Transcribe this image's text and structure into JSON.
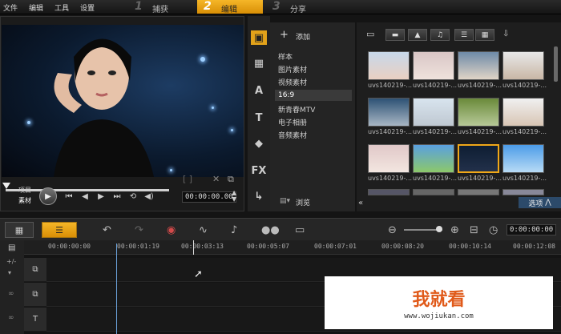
{
  "menu": {
    "file": "文件",
    "edit": "编辑",
    "tools": "工具",
    "settings": "设置"
  },
  "steps": [
    {
      "num": "1",
      "label": "捕获",
      "active": false
    },
    {
      "num": "2",
      "label": "编辑",
      "active": true
    },
    {
      "num": "3",
      "label": "分享",
      "active": false
    }
  ],
  "preview": {
    "project_label": "项目",
    "clip_label": "素材",
    "timecode": "00:00:00.00"
  },
  "library": {
    "add_label": "添加",
    "items": [
      "样本",
      "图片素材",
      "视频素材",
      "16:9",
      "新青春MTV",
      "电子相册",
      "音频素材"
    ],
    "selected_index": 3,
    "browse_label": "浏览"
  },
  "thumbs": {
    "captions": [
      "uvs140219-...",
      "uvs140219-...",
      "uvs140219-...",
      "uvs140219-...",
      "uvs140219-...",
      "uvs140219-...",
      "uvs140219-...",
      "uvs140219-...",
      "uvs140219-...",
      "uvs140219-...",
      "uvs140219-...",
      "uvs140219-..."
    ],
    "options_label": "选项"
  },
  "timeline": {
    "total_time": "0:00:00:00",
    "ticks": [
      "00:00:00:00",
      "00:00:01:19",
      "00:00:03:13",
      "00:00:05:07",
      "00:00:07:01",
      "00:00:08:20",
      "00:00:10:14",
      "00:00:12:08"
    ]
  },
  "watermark": {
    "brand": "我就看",
    "url": "www.wojiukan.com"
  },
  "colors": {
    "accent": "#f0a818",
    "bg": "#141414"
  }
}
